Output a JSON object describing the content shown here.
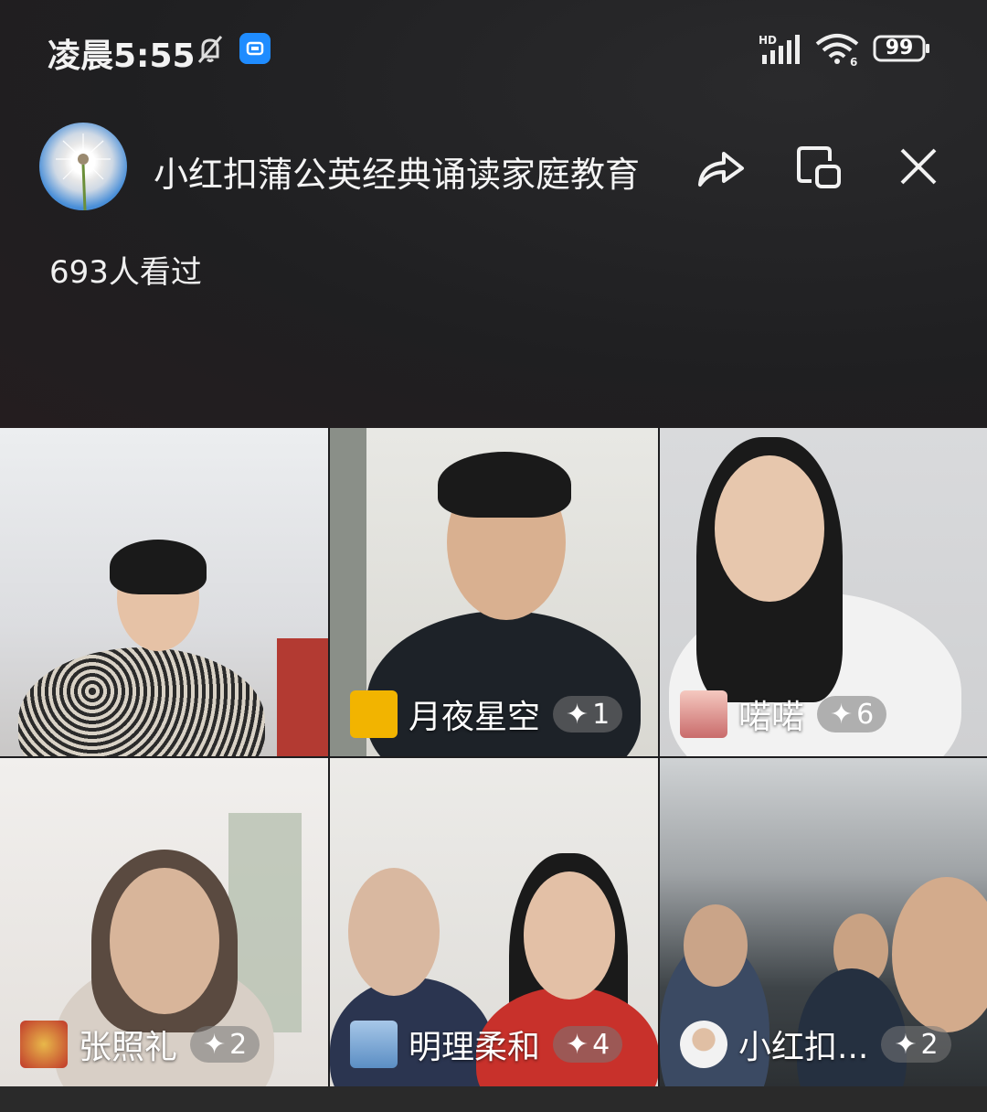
{
  "status_bar": {
    "time": "凌晨5:55",
    "battery": "99",
    "network": "HD"
  },
  "header": {
    "title": "小红扣蒲公英经典诵读家庭教育",
    "viewers": "693人看过"
  },
  "participants": [
    {
      "name": "",
      "gifts": ""
    },
    {
      "name": "月夜星空",
      "gifts": "1"
    },
    {
      "name": "喏喏",
      "gifts": "6"
    },
    {
      "name": "张照礼",
      "gifts": "2"
    },
    {
      "name": "明理柔和",
      "gifts": "4"
    },
    {
      "name": "小红扣...",
      "gifts": "2"
    }
  ],
  "icons": {
    "share": "share-icon",
    "pip": "picture-in-picture-icon",
    "close": "close-icon",
    "badge": "sparkle-icon"
  },
  "colors": {
    "app_badge": "#1f8cff",
    "background": "#1d1d1f"
  }
}
